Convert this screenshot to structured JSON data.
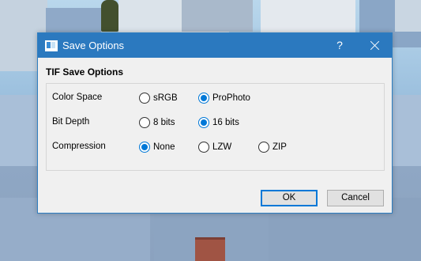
{
  "dialog": {
    "title": "Save Options",
    "help_label": "?",
    "section_title": "TIF Save Options",
    "rows": [
      {
        "label": "Color Space",
        "options": [
          {
            "label": "sRGB",
            "checked": false
          },
          {
            "label": "ProPhoto",
            "checked": true
          }
        ]
      },
      {
        "label": "Bit Depth",
        "options": [
          {
            "label": "8 bits",
            "checked": false
          },
          {
            "label": "16 bits",
            "checked": true
          }
        ]
      },
      {
        "label": "Compression",
        "options": [
          {
            "label": "None",
            "checked": true
          },
          {
            "label": "LZW",
            "checked": false
          },
          {
            "label": "ZIP",
            "checked": false
          }
        ]
      }
    ],
    "ok_label": "OK",
    "cancel_label": "Cancel",
    "accent_color": "#0078d7",
    "titlebar_color": "#2b79bf"
  }
}
